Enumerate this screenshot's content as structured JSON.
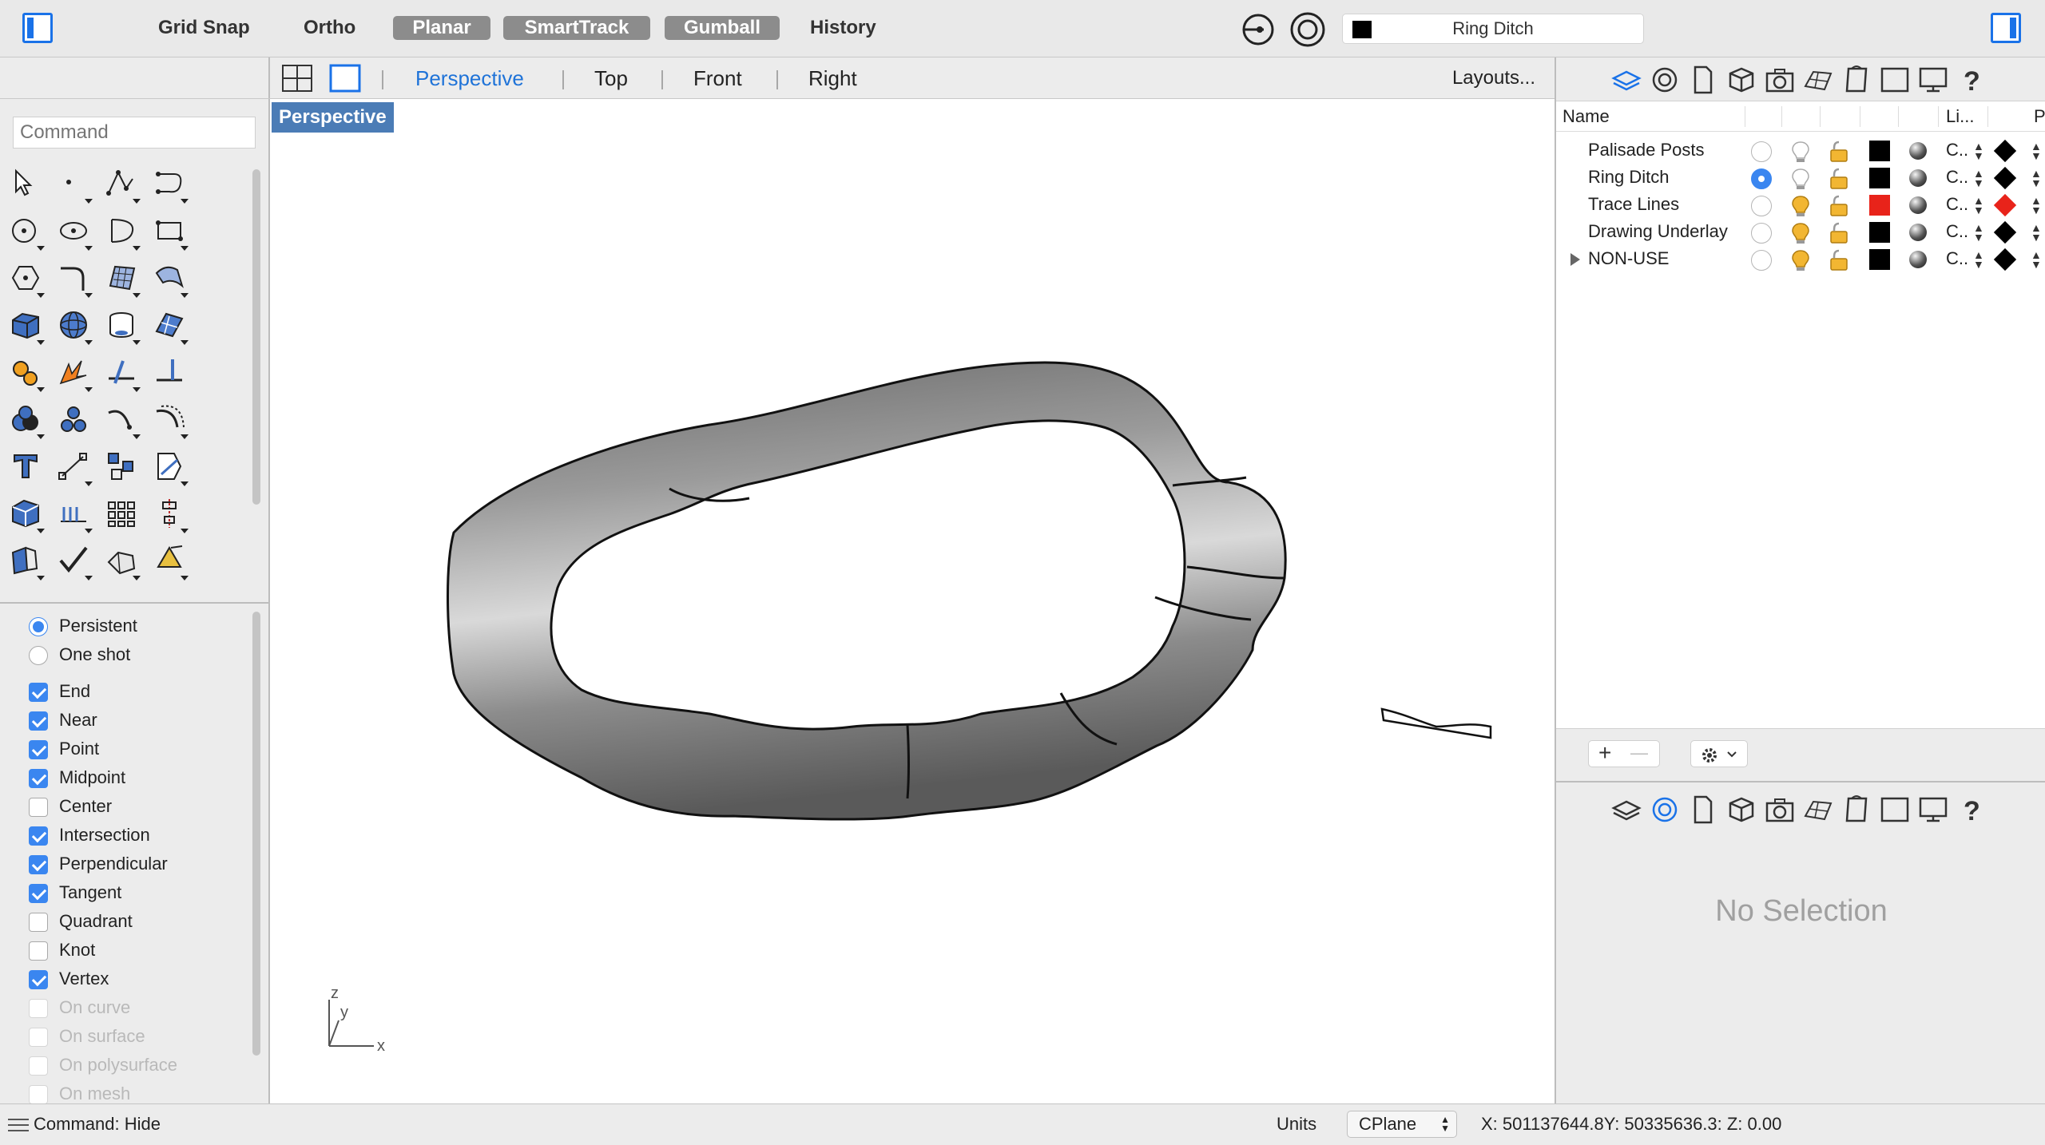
{
  "toolbar": {
    "buttons": [
      "Grid Snap",
      "Ortho",
      "Planar",
      "SmartTrack",
      "Gumball",
      "History"
    ],
    "current_layer": "Ring Ditch"
  },
  "viewport_tabs": {
    "tabs": [
      "Perspective",
      "Top",
      "Front",
      "Right"
    ],
    "active": "Perspective",
    "layouts": "Layouts..."
  },
  "viewport": {
    "label": "Perspective",
    "axes": {
      "x": "x",
      "y": "y",
      "z": "z"
    }
  },
  "command": {
    "placeholder": "Command"
  },
  "osnap": {
    "modes": [
      "Persistent",
      "One shot"
    ],
    "items": [
      {
        "label": "End",
        "checked": true,
        "enabled": true
      },
      {
        "label": "Near",
        "checked": true,
        "enabled": true
      },
      {
        "label": "Point",
        "checked": true,
        "enabled": true
      },
      {
        "label": "Midpoint",
        "checked": true,
        "enabled": true
      },
      {
        "label": "Center",
        "checked": false,
        "enabled": true
      },
      {
        "label": "Intersection",
        "checked": true,
        "enabled": true
      },
      {
        "label": "Perpendicular",
        "checked": true,
        "enabled": true
      },
      {
        "label": "Tangent",
        "checked": true,
        "enabled": true
      },
      {
        "label": "Quadrant",
        "checked": false,
        "enabled": true
      },
      {
        "label": "Knot",
        "checked": false,
        "enabled": true
      },
      {
        "label": "Vertex",
        "checked": true,
        "enabled": true
      },
      {
        "label": "On curve",
        "checked": false,
        "enabled": false
      },
      {
        "label": "On surface",
        "checked": false,
        "enabled": false
      },
      {
        "label": "On polysurface",
        "checked": false,
        "enabled": false
      },
      {
        "label": "On mesh",
        "checked": false,
        "enabled": false
      }
    ]
  },
  "layers": {
    "headers": {
      "name": "Name",
      "linetype": "Li...",
      "print": "P"
    },
    "rows": [
      {
        "name": "Palisade Posts",
        "current": false,
        "visible": false,
        "color": "#000000",
        "linetype": "C..",
        "print_color": "#000000"
      },
      {
        "name": "Ring Ditch",
        "current": true,
        "visible": false,
        "color": "#000000",
        "linetype": "C..",
        "print_color": "#000000"
      },
      {
        "name": "Trace Lines",
        "current": false,
        "visible": true,
        "color": "#e8231a",
        "linetype": "C..",
        "print_color": "#e8231a"
      },
      {
        "name": "Drawing Underlay",
        "current": false,
        "visible": true,
        "color": "#000000",
        "linetype": "C..",
        "print_color": "#000000"
      },
      {
        "name": "NON-USE",
        "current": false,
        "visible": true,
        "color": "#000000",
        "linetype": "C..",
        "print_color": "#000000",
        "expandable": true
      }
    ],
    "add_label": "+",
    "remove_label": "—"
  },
  "properties": {
    "empty_text": "No Selection"
  },
  "status": {
    "command_line": "Command: Hide",
    "units_label": "Units",
    "cplane": "CPlane",
    "coordinates": "X: 501137644.8Y: 50335636.3: Z: 0.00"
  },
  "colors": {
    "accent": "#1a72e8",
    "viewport_label_bg": "#4b7cb6",
    "toggle_on": "#8c8c8c"
  }
}
